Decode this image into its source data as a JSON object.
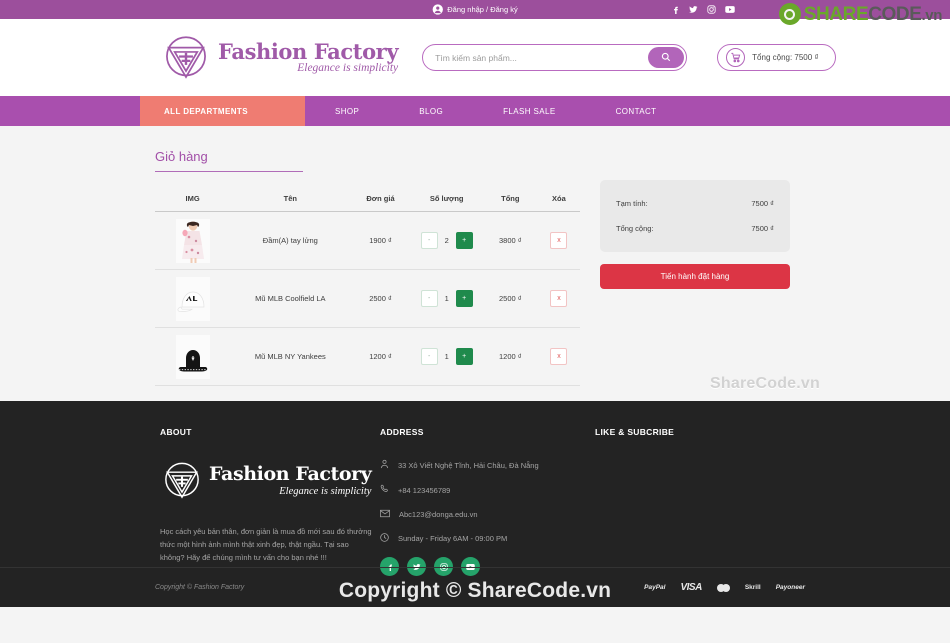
{
  "topbar": {
    "login_label": "Đăng nhập / Đăng ký",
    "social": [
      {
        "name": "facebook-icon"
      },
      {
        "name": "twitter-icon"
      },
      {
        "name": "instagram-icon"
      },
      {
        "name": "youtube-icon"
      }
    ]
  },
  "sharecode": {
    "share": "SHARE",
    "code": "CODE",
    "vn": ".vn"
  },
  "brand": {
    "name": "Fashion Factory",
    "tagline": "Elegance is simplicity"
  },
  "search": {
    "placeholder": "Tìm kiếm sản phẩm...",
    "value": "",
    "button_icon": "search-icon"
  },
  "cart_pill": {
    "label": "Tổng cộng: 7500 ₫",
    "icon": "shopping-cart-icon"
  },
  "nav": {
    "departments": "ALL DEPARTMENTS",
    "links": [
      "SHOP",
      "BLOG",
      "FLASH SALE",
      "CONTACT"
    ]
  },
  "cart": {
    "title": "Giỏ hàng",
    "columns": [
      "IMG",
      "Tên",
      "Đơn giá",
      "Số lượng",
      "Tổng",
      "Xóa"
    ],
    "minus_label": "-",
    "plus_label": "+",
    "delete_label": "x",
    "rows": [
      {
        "image": "dress-thumbnail",
        "name": "Đầm(A) tay lửng",
        "price": "1900 ₫",
        "qty": "2",
        "total": "3800 ₫"
      },
      {
        "image": "white-cap-thumbnail",
        "name": "Mũ MLB Coolfield LA",
        "price": "2500 ₫",
        "qty": "1",
        "total": "2500 ₫"
      },
      {
        "image": "black-bucket-hat-thumbnail",
        "name": "Mũ MLB NY Yankees",
        "price": "1200 ₫",
        "qty": "1",
        "total": "1200 ₫"
      }
    ]
  },
  "summary": {
    "subtotal_label": "Tạm tính:",
    "subtotal_value": "7500 ₫",
    "total_label": "Tổng cộng:",
    "total_value": "7500 ₫",
    "checkout_label": "Tiến hành đặt hàng"
  },
  "watermarks": {
    "main": "ShareCode.vn",
    "footer": "Copyright © ShareCode.vn"
  },
  "footer": {
    "about": {
      "heading": "ABOUT",
      "logo_name": "Fashion Factory",
      "logo_tagline": "Elegance is simplicity",
      "text": "Học cách yêu bản thân, đơn giản là mua đồ mới sau đó thưởng thức một hình ảnh mình thật xinh đẹp, thật ngầu. Tại sao không? Hãy để chúng mình tư vấn cho bạn nhé !!!"
    },
    "address": {
      "heading": "ADDRESS",
      "lines": [
        {
          "icon": "location-pin-icon",
          "text": "33 Xô Viết Nghệ Tĩnh, Hải Châu, Đà Nẵng"
        },
        {
          "icon": "phone-icon",
          "text": "+84 123456789"
        },
        {
          "icon": "envelope-icon",
          "text": "Abc123@donga.edu.vn"
        },
        {
          "icon": "clock-icon",
          "text": "Sunday - Friday 6AM - 09:00 PM"
        }
      ],
      "social": [
        {
          "name": "facebook-icon"
        },
        {
          "name": "twitter-icon"
        },
        {
          "name": "instagram-icon"
        },
        {
          "name": "youtube-icon"
        }
      ]
    },
    "like": {
      "heading": "LIKE & SUBCRIBE"
    },
    "copyright": "Copyright © Fashion Factory",
    "payments": [
      "PayPal",
      "VISA",
      "mastercard",
      "Skrill",
      "Payoneer"
    ]
  },
  "colors": {
    "purple": "#a94fae",
    "topbar_purple": "#9c4f9c",
    "coral": "#ef7c72",
    "green": "#1f8a4c",
    "red": "#dc3545",
    "footer_dark": "#232323",
    "sharecode_green": "#6aa82a"
  }
}
